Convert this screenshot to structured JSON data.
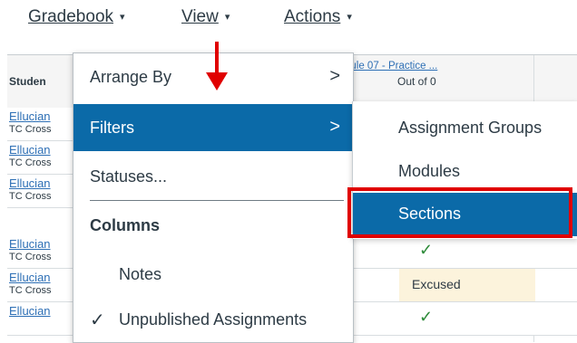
{
  "toolbar": {
    "gradebook": "Gradebook",
    "view": "View",
    "actions": "Actions",
    "caret": "▾"
  },
  "grid": {
    "student_col": "Studen",
    "assignment_title": "dule 07 - Practice ...",
    "assignment_sub": "Out of 0",
    "rows": [
      {
        "name": "Ellucian",
        "section": "TC Cross",
        "cell": ""
      },
      {
        "name": "Ellucian",
        "section": "TC Cross",
        "cell": ""
      },
      {
        "name": "Ellucian",
        "section": "TC Cross",
        "cell": ""
      },
      {
        "name": "Ellucian",
        "section": "TC Cross",
        "cell": "✓"
      },
      {
        "name": "Ellucian",
        "section": "TC Cross",
        "cell": "Excused"
      },
      {
        "name": "Ellucian",
        "section": "",
        "cell": "✓"
      }
    ]
  },
  "view_menu": {
    "arrange_by": "Arrange By",
    "filters": "Filters",
    "statuses": "Statuses...",
    "columns_header": "Columns",
    "notes": "Notes",
    "unpublished": "Unpublished Assignments",
    "chevron": ">",
    "check": "✓"
  },
  "filters_submenu": {
    "items": [
      "Assignment Groups",
      "Modules",
      "Sections"
    ],
    "selected": "Sections"
  },
  "colors": {
    "accent": "#0b6aa8",
    "annotation_red": "#e00000",
    "excused_bg": "#fcf3dc",
    "check_green": "#2e8b3a"
  }
}
